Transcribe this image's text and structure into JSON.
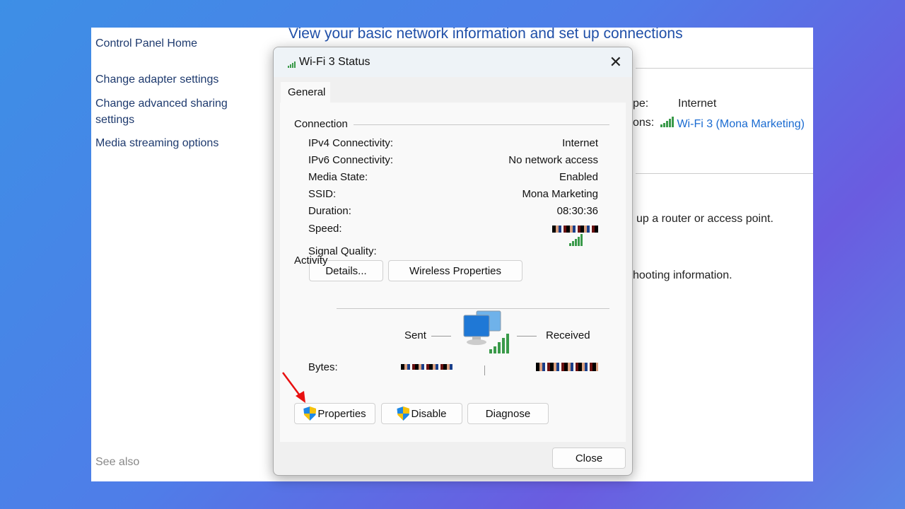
{
  "sidebar": {
    "items": [
      {
        "label": "Control Panel Home"
      },
      {
        "label": "Change adapter settings"
      },
      {
        "label": "Change advanced sharing settings"
      },
      {
        "label": "Media streaming options"
      }
    ],
    "see_also": "See also"
  },
  "main": {
    "title": "View your basic network information and set up connections",
    "access_type_label_partial": "pe:",
    "access_type_value": "Internet",
    "connections_label_partial": "ons:",
    "connection_link": "Wi-Fi 3 (Mona Marketing)",
    "router_text_partial": "up a router or access point.",
    "troubleshoot_text_partial": "hooting information."
  },
  "dialog": {
    "title": "Wi-Fi 3 Status",
    "tab": "General",
    "connection": {
      "heading": "Connection",
      "rows": [
        {
          "label": "IPv4 Connectivity:",
          "value": "Internet"
        },
        {
          "label": "IPv6 Connectivity:",
          "value": "No network access"
        },
        {
          "label": "Media State:",
          "value": "Enabled"
        },
        {
          "label": "SSID:",
          "value": "Mona Marketing"
        },
        {
          "label": "Duration:",
          "value": "08:30:36"
        },
        {
          "label": "Speed:",
          "value": ""
        }
      ],
      "signal_label": "Signal Quality:",
      "signal_level": "5 of 5 bars"
    },
    "buttons": {
      "details": "Details...",
      "wireless": "Wireless Properties",
      "properties": "Properties",
      "disable": "Disable",
      "diagnose": "Diagnose",
      "close": "Close"
    },
    "activity": {
      "heading": "Activity",
      "sent": "Sent",
      "received": "Received",
      "bytes_label": "Bytes:"
    }
  },
  "colors": {
    "accent_link": "#1a6bd1",
    "signal_green": "#3a9a4a",
    "arrow_red": "#e81010"
  }
}
